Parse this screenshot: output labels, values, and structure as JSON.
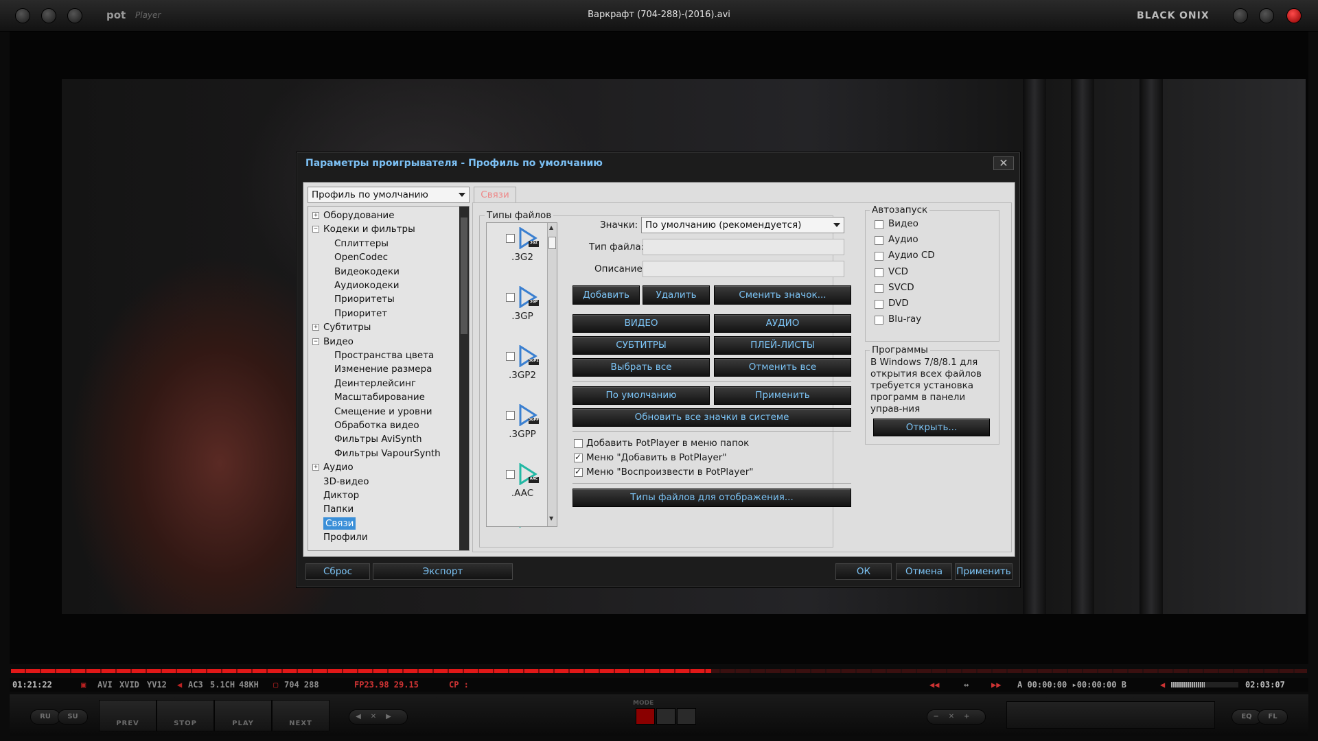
{
  "window": {
    "title": "Варкрафт (704-288)-(2016).avi",
    "logo": "PotPlayer",
    "logo_main": "pot",
    "logo_sub": "Player",
    "skin_left": "BLACK",
    "skin_right": "ONIX"
  },
  "dialog": {
    "title": "Параметры проигрывателя - Профиль по умолчанию",
    "close": "✕",
    "profile_combo": "Профиль по умолчанию",
    "tab": "Связи",
    "tree": [
      {
        "label": "Оборудование",
        "level": 0,
        "expander": "+"
      },
      {
        "label": "Кодеки и фильтры",
        "level": 0,
        "expander": "−"
      },
      {
        "label": "Сплиттеры",
        "level": 1
      },
      {
        "label": "OpenCodec",
        "level": 1
      },
      {
        "label": "Видеокодеки",
        "level": 1
      },
      {
        "label": "Аудиокодеки",
        "level": 1
      },
      {
        "label": "Приоритеты",
        "level": 1
      },
      {
        "label": "Приоритет",
        "level": 1
      },
      {
        "label": "Субтитры",
        "level": 0,
        "expander": "+"
      },
      {
        "label": "Видео",
        "level": 0,
        "expander": "−"
      },
      {
        "label": "Пространства цвета",
        "level": 1
      },
      {
        "label": "Изменение размера",
        "level": 1
      },
      {
        "label": "Деинтерлейсинг",
        "level": 1
      },
      {
        "label": "Масштабирование",
        "level": 1
      },
      {
        "label": "Смещение и уровни",
        "level": 1
      },
      {
        "label": "Обработка видео",
        "level": 1
      },
      {
        "label": "Фильтры AviSynth",
        "level": 1
      },
      {
        "label": "Фильтры VapourSynth",
        "level": 1
      },
      {
        "label": "Аудио",
        "level": 0,
        "expander": "+"
      },
      {
        "label": "3D-видео",
        "level": 0
      },
      {
        "label": "Диктор",
        "level": 0
      },
      {
        "label": "Папки",
        "level": 0
      },
      {
        "label": "Связи",
        "level": 0,
        "selected": true
      },
      {
        "label": "Профили",
        "level": 0
      }
    ],
    "file_types": {
      "group_label": "Типы файлов",
      "items": [
        {
          "name": ".3G2",
          "badge": "3G2",
          "color": "#3a7fd0"
        },
        {
          "name": ".3GP",
          "badge": "3GP",
          "color": "#3a7fd0"
        },
        {
          "name": ".3GP2",
          "badge": "3GP2",
          "color": "#3a7fd0"
        },
        {
          "name": ".3GPP",
          "badge": "3GPP",
          "color": "#3a7fd0"
        },
        {
          "name": ".AAC",
          "badge": "AAC",
          "color": "#22b8a4"
        }
      ]
    },
    "icons_label": "Значки:",
    "icons_value": "По умолчанию (рекомендуется)",
    "file_type_label": "Тип файла:",
    "description_label": "Описание:",
    "buttons": {
      "add": "Добавить",
      "delete": "Удалить",
      "change_icon": "Сменить значок...",
      "video": "ВИДЕО",
      "audio": "АУДИО",
      "subtitles": "СУБТИТРЫ",
      "playlists": "ПЛЕЙ-ЛИСТЫ",
      "select_all": "Выбрать все",
      "deselect_all": "Отменить все",
      "default": "По умолчанию",
      "apply": "Применить",
      "refresh_icons": "Обновить все значки в системе",
      "display_types": "Типы файлов для отображения..."
    },
    "context_menu": [
      {
        "label": "Добавить PotPlayer в меню папок",
        "checked": false
      },
      {
        "label": "Меню \"Добавить в PotPlayer\"",
        "checked": true
      },
      {
        "label": "Меню \"Воспроизвести в PotPlayer\"",
        "checked": true
      }
    ],
    "autorun": {
      "label": "Автозапуск",
      "items": [
        {
          "label": "Видео",
          "checked": false
        },
        {
          "label": "Аудио",
          "checked": false
        },
        {
          "label": "Аудио CD",
          "checked": false
        },
        {
          "label": "VCD",
          "checked": false
        },
        {
          "label": "SVCD",
          "checked": false
        },
        {
          "label": "DVD",
          "checked": false
        },
        {
          "label": "Blu-ray",
          "checked": false
        }
      ]
    },
    "programs": {
      "label": "Программы",
      "text_lines": [
        "В Windows 7/8/8.1 для",
        "открытия всех файлов",
        "требуется установка",
        "программ в панели",
        "управ-ния"
      ],
      "open_button": "Открыть..."
    },
    "footer": {
      "reset": "Сброс",
      "export": "Экспорт",
      "ok": "ОК",
      "cancel": "Отмена",
      "apply": "Применить"
    }
  },
  "playback": {
    "time": "01:21:22",
    "duration": "02:03:07",
    "progress": 0.54,
    "container": "AVI",
    "vcodec": "XVID",
    "pixfmt": "YV12",
    "acodec": "AC3",
    "channels": "5.1CH",
    "samplerate": "48KH",
    "resolution": "704  288",
    "fps": "FP23.98  29.15",
    "cp": "CP :",
    "ab": "A 00:00:00 ▸00:00:00 B",
    "volume_level": 0.5,
    "controls": {
      "ru": "RU",
      "su": "SU",
      "prev": "PREV",
      "stop": "STOP",
      "play": "PLAY",
      "next": "NEXT",
      "mode": "MODE",
      "eq": "EQ",
      "pl": "FL"
    }
  }
}
